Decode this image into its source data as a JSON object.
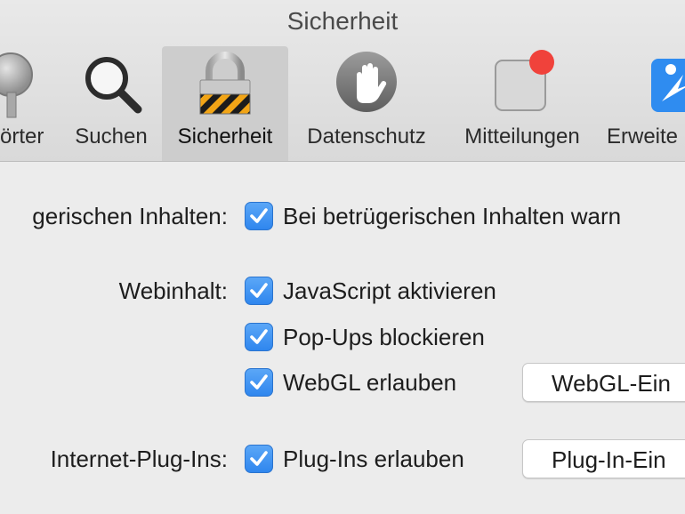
{
  "window": {
    "title": "Sicherheit"
  },
  "toolbar": {
    "tabs": [
      {
        "label": "örter",
        "icon": "key-icon"
      },
      {
        "label": "Suchen",
        "icon": "magnifier-icon"
      },
      {
        "label": "Sicherheit",
        "icon": "padlock-icon",
        "active": true
      },
      {
        "label": "Datenschutz",
        "icon": "hand-icon"
      },
      {
        "label": "Mitteilungen",
        "icon": "notification-badge-icon"
      },
      {
        "label": "Erweite",
        "icon": "extensions-icon"
      }
    ]
  },
  "settings": {
    "fraud": {
      "label": "gerischen Inhalten:",
      "option": "Bei betrügerischen Inhalten warn",
      "checked": true
    },
    "web_content": {
      "label": "Webinhalt:",
      "options": [
        {
          "text": "JavaScript aktivieren",
          "checked": true
        },
        {
          "text": "Pop-Ups blockieren",
          "checked": true
        },
        {
          "text": "WebGL erlauben",
          "checked": true,
          "button": "WebGL-Ein"
        }
      ]
    },
    "plugins": {
      "label": "Internet-Plug-Ins:",
      "option": "Plug-Ins erlauben",
      "checked": true,
      "button": "Plug-In-Ein"
    }
  },
  "colors": {
    "accent": "#3a8ef0",
    "badge": "#f0423b"
  }
}
